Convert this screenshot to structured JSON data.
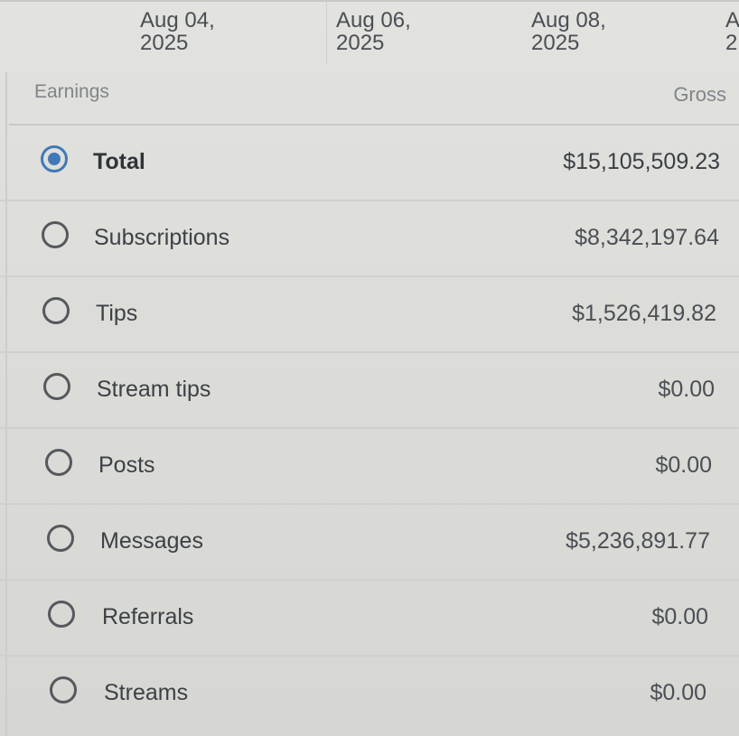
{
  "date_axis": [
    {
      "month_day": "Aug 04,",
      "year": "2025"
    },
    {
      "month_day": "Aug 06,",
      "year": "2025"
    },
    {
      "month_day": "Aug 08,",
      "year": "2025"
    },
    {
      "month_day": "A",
      "year": "2"
    }
  ],
  "header": {
    "left_label": "Earnings",
    "right_label": "Gross"
  },
  "categories": [
    {
      "label": "Total",
      "amount": "$15,105,509.23",
      "selected": true
    },
    {
      "label": "Subscriptions",
      "amount": "$8,342,197.64",
      "selected": false
    },
    {
      "label": "Tips",
      "amount": "$1,526,419.82",
      "selected": false
    },
    {
      "label": "Stream tips",
      "amount": "$0.00",
      "selected": false
    },
    {
      "label": "Posts",
      "amount": "$0.00",
      "selected": false
    },
    {
      "label": "Messages",
      "amount": "$5,236,891.77",
      "selected": false
    },
    {
      "label": "Referrals",
      "amount": "$0.00",
      "selected": false
    },
    {
      "label": "Streams",
      "amount": "$0.00",
      "selected": false
    }
  ],
  "colors": {
    "accent": "#3f79b8",
    "background": "#dcdcd8",
    "text": "#3a3f44",
    "muted_text": "#80858a"
  }
}
